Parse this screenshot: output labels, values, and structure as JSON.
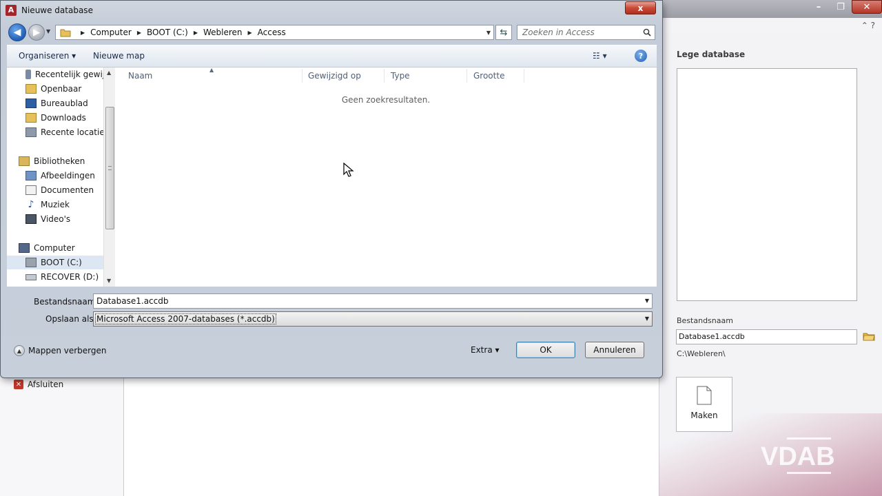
{
  "dialog": {
    "title": "Nieuwe database",
    "close_label": "x",
    "address": {
      "crumbs": [
        "Computer",
        "BOOT (C:)",
        "Webleren",
        "Access"
      ]
    },
    "search_placeholder": "Zoeken in Access",
    "toolbar": {
      "organize_label": "Organiseren ▾",
      "new_folder_label": "Nieuwe map",
      "views_label": "☷ ▾",
      "help_label": "?"
    },
    "nav_items": [
      {
        "label": "Recentelijk gewijzigd",
        "icon": "recent-icon"
      },
      {
        "label": "Openbaar",
        "icon": "folder-icon"
      },
      {
        "label": "Bureaublad",
        "icon": "desktop-icon"
      },
      {
        "label": "Downloads",
        "icon": "downloads-icon"
      },
      {
        "label": "Recente locaties",
        "icon": "recent-places-icon"
      },
      {
        "label": "Bibliotheken",
        "icon": "libraries-icon"
      },
      {
        "label": "Afbeeldingen",
        "icon": "pictures-icon"
      },
      {
        "label": "Documenten",
        "icon": "documents-icon"
      },
      {
        "label": "Muziek",
        "icon": "music-icon"
      },
      {
        "label": "Video's",
        "icon": "video-icon"
      },
      {
        "label": "Computer",
        "icon": "computer-icon"
      },
      {
        "label": "BOOT (C:)",
        "icon": "drive-icon"
      },
      {
        "label": "RECOVER (D:)",
        "icon": "drive-icon"
      }
    ],
    "columns": [
      "Naam",
      "Gewijzigd op",
      "Type",
      "Grootte"
    ],
    "empty_message": "Geen zoekresultaten.",
    "filename_label": "Bestandsnaam:",
    "filename_value": "Database1.accdb",
    "savetype_label": "Opslaan als:",
    "savetype_value": "Microsoft Access 2007-databases (*.accdb)",
    "hide_folders_label": "Mappen verbergen",
    "extra_label": "Extra  ▾",
    "ok_label": "OK",
    "cancel_label": "Annuleren"
  },
  "background": {
    "window_buttons": [
      "–",
      "❐",
      "✕"
    ],
    "help_icons": "⌃  ?",
    "exit_label": "Afsluiten",
    "right_panel": {
      "title": "Lege database",
      "filename_label": "Bestandsnaam",
      "filename_value": "Database1.accdb",
      "path": "C:\\Webleren\\",
      "create_label": "Maken"
    },
    "logo_text": "VDAB"
  },
  "colors": {
    "accent_close": "#c94a36",
    "access_brand": "#a4262c",
    "logo_purple": "#7d2d5a"
  }
}
